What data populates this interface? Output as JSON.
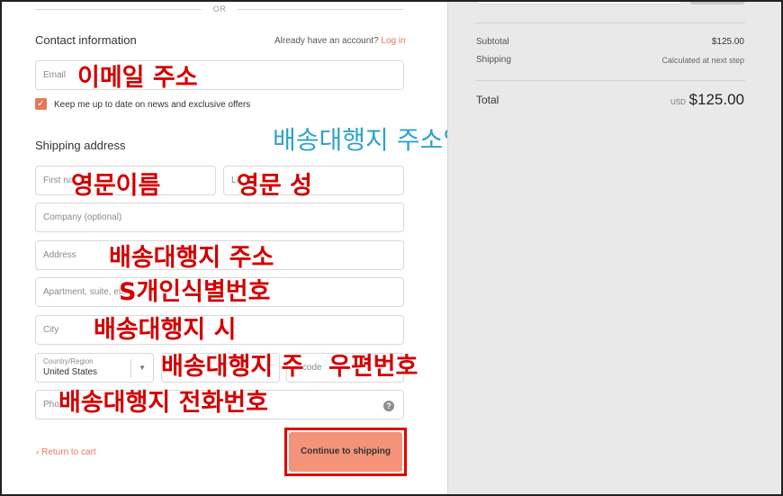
{
  "divider_text": "OR",
  "contact": {
    "title": "Contact information",
    "have_account": "Already have an account?",
    "login_link": "Log in",
    "email_placeholder": "Email",
    "newsletter_label": "Keep me up to date on news and exclusive offers",
    "newsletter_checked": true
  },
  "shipping": {
    "title": "Shipping address",
    "first_name_placeholder": "First na",
    "last_name_placeholder": "La",
    "company_placeholder": "Company (optional)",
    "address_placeholder": "Address",
    "apartment_placeholder": "Apartment, suite, etc.",
    "city_placeholder": "City",
    "country_label": "Country/Region",
    "country_value": "United States",
    "state_placeholder": "St",
    "zip_placeholder": "Z  code",
    "phone_placeholder": "Pho",
    "help_icon": "?"
  },
  "footer": {
    "return_label": "Return to cart",
    "continue_label": "Continue to shipping"
  },
  "summary": {
    "subtotal_label": "Subtotal",
    "subtotal_value": "$125.00",
    "shipping_label": "Shipping",
    "shipping_value": "Calculated at next step",
    "total_label": "Total",
    "total_currency": "USD",
    "total_value": "$125.00"
  },
  "annotations": {
    "email": "이메일 주소",
    "instruction": "배송대행지 주소입력하기",
    "first_name": "영문이름",
    "last_name": "영문 성",
    "address": "배송대행지 주소",
    "apartment": "S개인식별번호",
    "city": "배송대행지 시",
    "state": "배송대행지 주",
    "zip": "우편번호",
    "phone": "배송대행지 전화번호"
  },
  "colors": {
    "accent": "#e8775a",
    "button": "#f4937a",
    "annotation_red": "#d20000",
    "annotation_teal": "#2fa3c9",
    "highlight_border": "#e00000",
    "sidebar_bg": "#e9e9e9"
  }
}
